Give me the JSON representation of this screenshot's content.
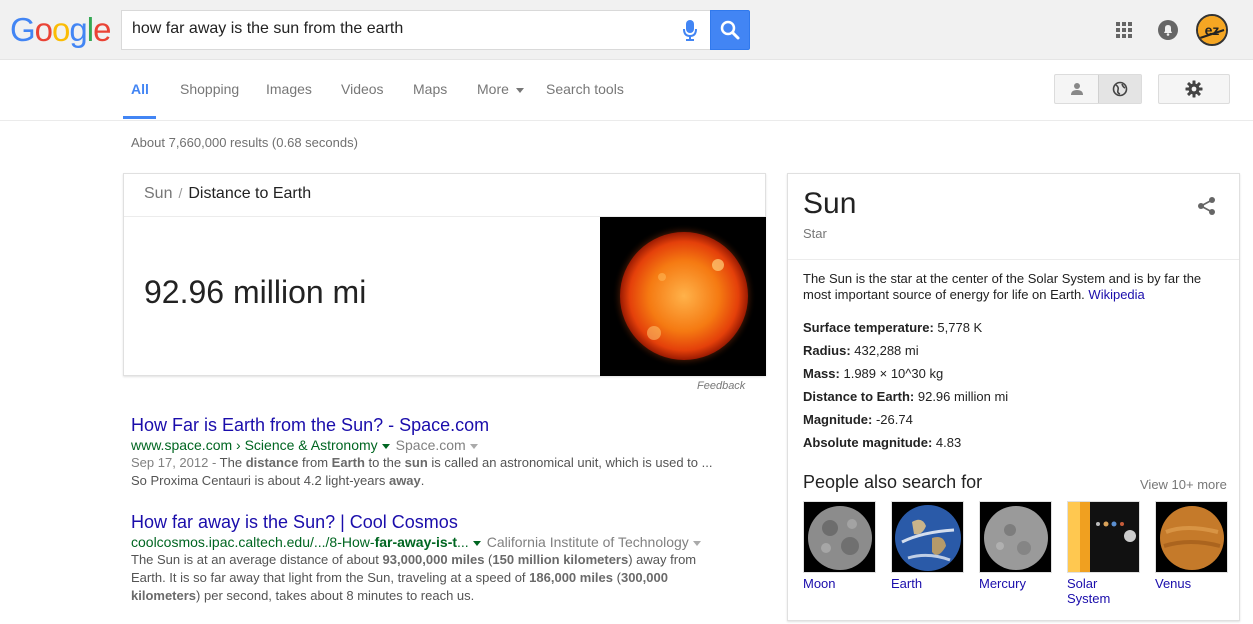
{
  "header": {
    "logo_letters": [
      "G",
      "o",
      "o",
      "g",
      "l",
      "e"
    ],
    "logo_colors": [
      "#4285f4",
      "#ea4335",
      "#fbbc05",
      "#4285f4",
      "#34a853",
      "#ea4335"
    ],
    "query": "how far away is the sun from the earth",
    "icons": [
      "mic-icon",
      "search-icon",
      "apps-grid-icon",
      "notifications-icon",
      "avatar"
    ],
    "avatar_text": "ez"
  },
  "tabs": {
    "items": [
      "All",
      "Shopping",
      "Images",
      "Videos",
      "Maps",
      "More",
      "Search tools"
    ],
    "active": "All"
  },
  "result_stats": "About 7,660,000 results (0.68 seconds)",
  "answer": {
    "entity": "Sun",
    "separator": "/",
    "attribute": "Distance to Earth",
    "value": "92.96 million mi",
    "feedback": "Feedback"
  },
  "results": [
    {
      "title": "How Far is Earth from the Sun? - Space.com",
      "url": "www.space.com › Science & Astronomy",
      "source": "Space.com",
      "date": "Sep 17, 2012 -",
      "snippet_1a": " The ",
      "snippet_1b": "distance",
      "snippet_1c": " from ",
      "snippet_1d": "Earth",
      "snippet_1e": " to the ",
      "snippet_1f": "sun",
      "snippet_1g": " is called an astronomical unit, which is used to ...",
      "snippet_2a": "So Proxima Centauri is about 4.2 light-years ",
      "snippet_2b": "away",
      "snippet_2c": "."
    },
    {
      "title": "How far away is the Sun? | Cool Cosmos",
      "url_a": "coolcosmos.ipac.caltech.edu/.../8-How-",
      "url_b": "far-away-is-t",
      "url_c": "...",
      "source": "California Institute of Technology",
      "snippet_1a": "The Sun is at an average distance of about ",
      "snippet_1b": "93,000,000 miles",
      "snippet_1c": " (",
      "snippet_1d": "150 million kilometers",
      "snippet_1e": ") away from",
      "snippet_2a": "Earth. It is so far away that light from the Sun, traveling at a speed of ",
      "snippet_2b": "186,000 miles",
      "snippet_2c": " (",
      "snippet_2d": "300,000",
      "snippet_3a": "kilometers",
      "snippet_3b": ") per second, takes about 8 minutes to reach us."
    }
  ],
  "knowledge_panel": {
    "title": "Sun",
    "subtitle": "Star",
    "description": "The Sun is the star at the center of the Solar System and is by far the most important source of energy for life on Earth. ",
    "source_link": "Wikipedia",
    "facts": [
      {
        "label": "Surface temperature:",
        "value": " 5,778 K"
      },
      {
        "label": "Radius:",
        "value": " 432,288 mi"
      },
      {
        "label": "Mass:",
        "value": " 1.989 × 10^30 kg"
      },
      {
        "label": "Distance to Earth:",
        "value": " 92.96 million mi"
      },
      {
        "label": "Magnitude:",
        "value": " -26.74"
      },
      {
        "label": "Absolute magnitude:",
        "value": " 4.83"
      }
    ],
    "people_also_search": {
      "title": "People also search for",
      "more": "View 10+ more",
      "items": [
        {
          "label": "Moon"
        },
        {
          "label": "Earth"
        },
        {
          "label": "Mercury"
        },
        {
          "label": "Solar System"
        },
        {
          "label": "Venus"
        }
      ]
    }
  }
}
